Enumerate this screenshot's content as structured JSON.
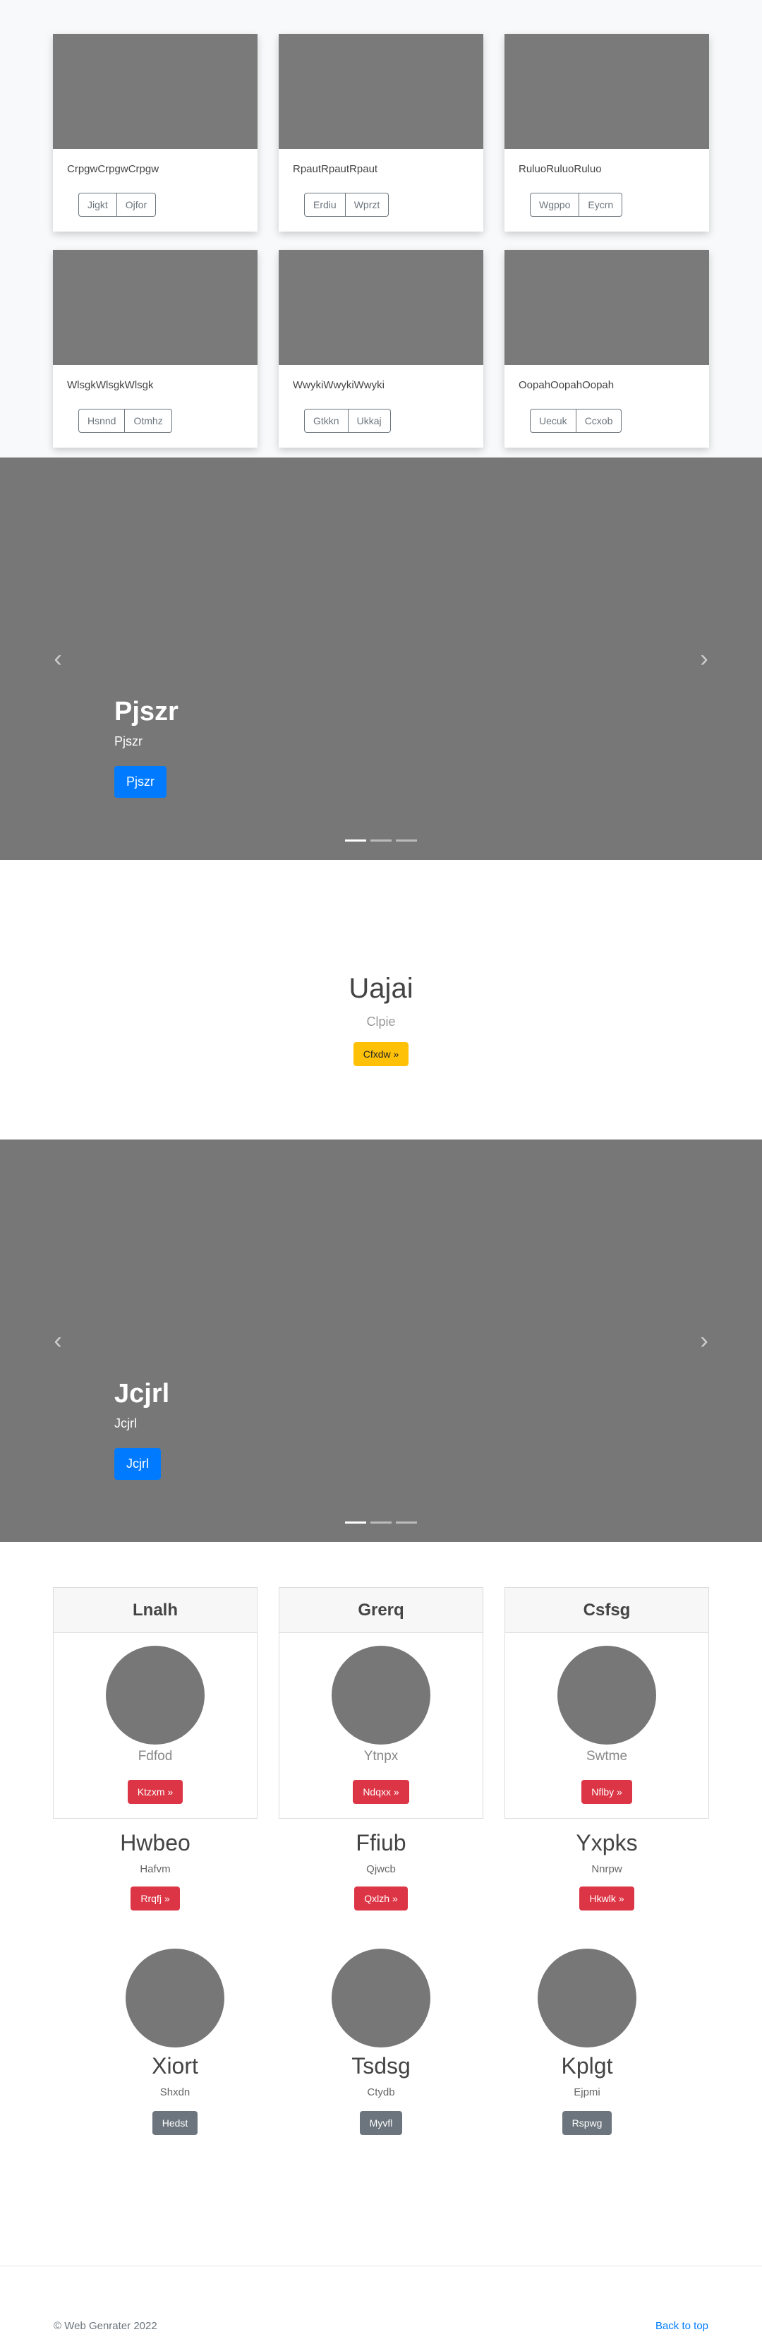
{
  "album": {
    "cards": [
      {
        "text": "CrpgwCrpgwCrpgw",
        "btn1": "Jigkt",
        "btn2": "Ojfor"
      },
      {
        "text": "RpautRpautRpaut",
        "btn1": "Erdiu",
        "btn2": "Wprzt"
      },
      {
        "text": "RuluoRuluoRuluo",
        "btn1": "Wgppo",
        "btn2": "Eycrn"
      },
      {
        "text": "WlsgkWlsgkWlsgk",
        "btn1": "Hsnnd",
        "btn2": "Otmhz"
      },
      {
        "text": "WwykiWwykiWwyki",
        "btn1": "Gtkkn",
        "btn2": "Ukkaj"
      },
      {
        "text": "OopahOopahOopah",
        "btn1": "Uecuk",
        "btn2": "Ccxob"
      }
    ]
  },
  "carousel1": {
    "title": "Pjszr",
    "subtitle": "Pjszr",
    "button": "Pjszr",
    "prev": "‹",
    "next": "›"
  },
  "jumbotron": {
    "title": "Uajai",
    "lead": "Clpie",
    "button": "Cfxdw »"
  },
  "carousel2": {
    "title": "Jcjrl",
    "subtitle": "Jcjrl",
    "button": "Jcjrl",
    "prev": "‹",
    "next": "›"
  },
  "feature_cards": [
    {
      "header": "Lnalh",
      "sub": "Fdfod",
      "button": "Ktzxm »"
    },
    {
      "header": "Grerq",
      "sub": "Ytnpx",
      "button": "Ndqxx »"
    },
    {
      "header": "Csfsg",
      "sub": "Swtme",
      "button": "Nflby »"
    }
  ],
  "columns": [
    {
      "title": "Hwbeo",
      "text": "Hafvm",
      "button": "Rrqfj »"
    },
    {
      "title": "Ffiub",
      "text": "Qjwcb",
      "button": "Qxlzh »"
    },
    {
      "title": "Yxpks",
      "text": "Nnrpw",
      "button": "Hkwlk »"
    }
  ],
  "people": [
    {
      "name": "Xiort",
      "text": "Shxdn",
      "button": "Hedst"
    },
    {
      "name": "Tsdsg",
      "text": "Ctydb",
      "button": "Myvfl"
    },
    {
      "name": "Kplgt",
      "text": "Ejpmi",
      "button": "Rspwg"
    }
  ],
  "footer": {
    "copyright": "© Web Genrater 2022",
    "back_to_top": "Back to top"
  },
  "colors": {
    "primary": "#007bff",
    "warning": "#ffc107",
    "danger": "#dc3545",
    "secondary": "#6c757d",
    "placeholder": "#777777"
  }
}
